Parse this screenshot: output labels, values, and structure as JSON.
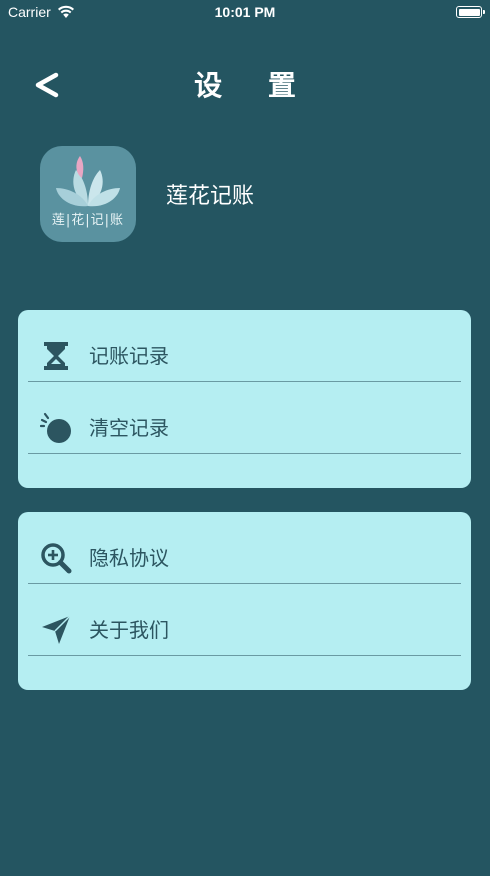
{
  "status_bar": {
    "carrier": "Carrier",
    "time": "10:01 PM"
  },
  "nav": {
    "back_label": "<",
    "title": "设 置"
  },
  "app": {
    "logo_text": "莲|花|记|账",
    "name": "莲花记账"
  },
  "groups": [
    {
      "items": [
        {
          "label": "记账记录",
          "icon": "hourglass-icon"
        },
        {
          "label": "清空记录",
          "icon": "clear-timer-icon"
        }
      ]
    },
    {
      "items": [
        {
          "label": "隐私协议",
          "icon": "zoom-in-icon"
        },
        {
          "label": "关于我们",
          "icon": "paper-plane-icon"
        }
      ]
    }
  ],
  "colors": {
    "background": "#245561",
    "card": "#b5eef2",
    "item_text": "#2c5560",
    "divider": "#6a9aa3"
  }
}
